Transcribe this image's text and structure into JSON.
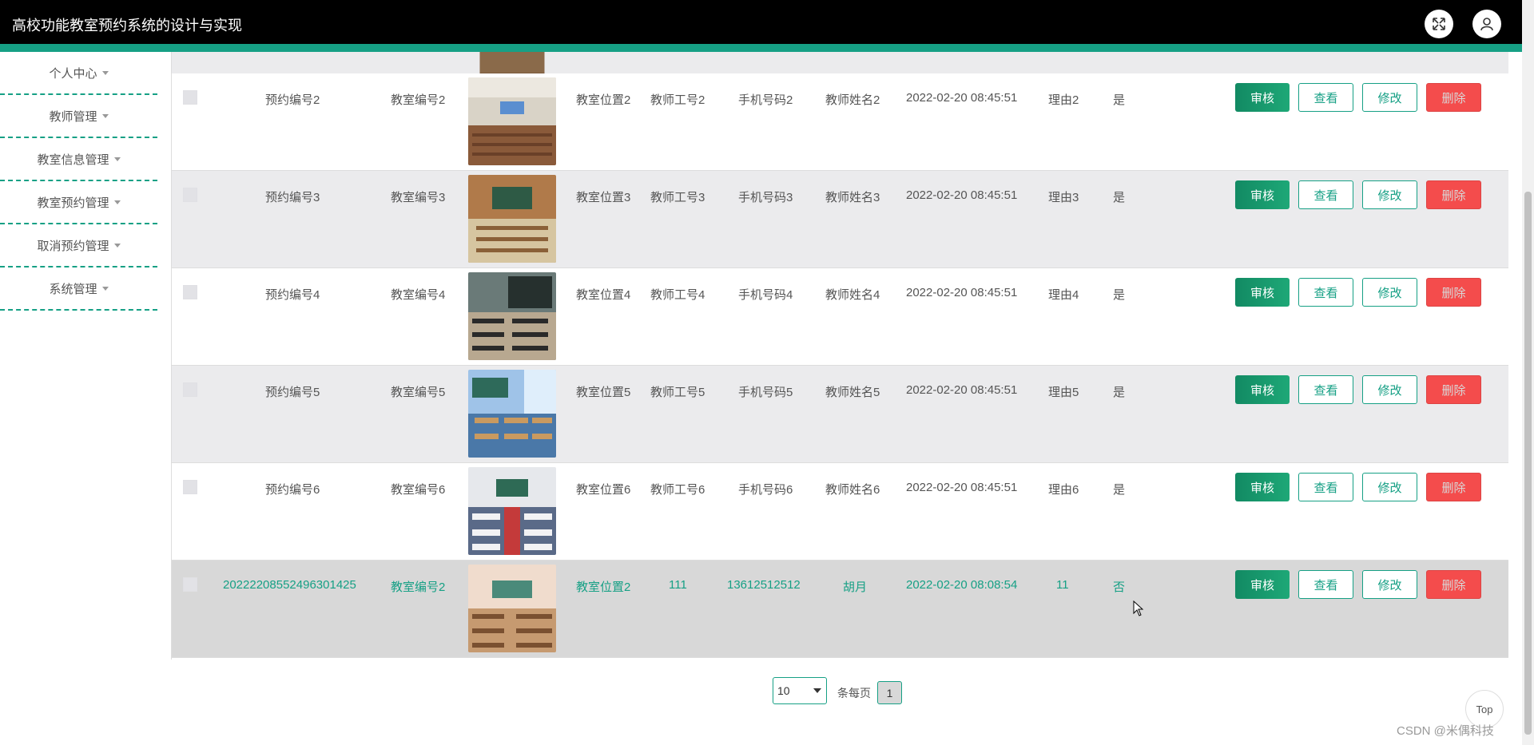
{
  "header": {
    "title": "高校功能教室预约系统的设计与实现"
  },
  "sidebar": {
    "items": [
      {
        "label": "个人中心"
      },
      {
        "label": "教师管理"
      },
      {
        "label": "教室信息管理"
      },
      {
        "label": "教室预约管理"
      },
      {
        "label": "取消预约管理"
      },
      {
        "label": "系统管理"
      }
    ]
  },
  "actions": {
    "audit": "审核",
    "view": "查看",
    "edit": "修改",
    "delete": "删除"
  },
  "rows": [
    {
      "order_no": "预约编号2",
      "room_no": "教室编号2",
      "location": "教室位置2",
      "teacher_id": "教师工号2",
      "phone": "手机号码2",
      "teacher_name": "教师姓名2",
      "time": "2022-02-20 08:45:51",
      "reason": "理由2",
      "approved": "是"
    },
    {
      "order_no": "预约编号3",
      "room_no": "教室编号3",
      "location": "教室位置3",
      "teacher_id": "教师工号3",
      "phone": "手机号码3",
      "teacher_name": "教师姓名3",
      "time": "2022-02-20 08:45:51",
      "reason": "理由3",
      "approved": "是"
    },
    {
      "order_no": "预约编号4",
      "room_no": "教室编号4",
      "location": "教室位置4",
      "teacher_id": "教师工号4",
      "phone": "手机号码4",
      "teacher_name": "教师姓名4",
      "time": "2022-02-20 08:45:51",
      "reason": "理由4",
      "approved": "是"
    },
    {
      "order_no": "预约编号5",
      "room_no": "教室编号5",
      "location": "教室位置5",
      "teacher_id": "教师工号5",
      "phone": "手机号码5",
      "teacher_name": "教师姓名5",
      "time": "2022-02-20 08:45:51",
      "reason": "理由5",
      "approved": "是"
    },
    {
      "order_no": "预约编号6",
      "room_no": "教室编号6",
      "location": "教室位置6",
      "teacher_id": "教师工号6",
      "phone": "手机号码6",
      "teacher_name": "教师姓名6",
      "time": "2022-02-20 08:45:51",
      "reason": "理由6",
      "approved": "是"
    },
    {
      "order_no": "20222208552496301425",
      "room_no": "教室编号2",
      "location": "教室位置2",
      "teacher_id": "111",
      "phone": "13612512512",
      "teacher_name": "胡月",
      "time": "2022-02-20 08:08:54",
      "reason": "11",
      "approved": "否"
    }
  ],
  "pagination": {
    "page_size": "10",
    "per_page_label": "条每页",
    "current_page": "1"
  },
  "top_button": "Top",
  "watermark": "CSDN @米偶科技",
  "colors": {
    "accent": "#16a085",
    "delete": "#f44c4c",
    "header_bg": "#000000"
  }
}
